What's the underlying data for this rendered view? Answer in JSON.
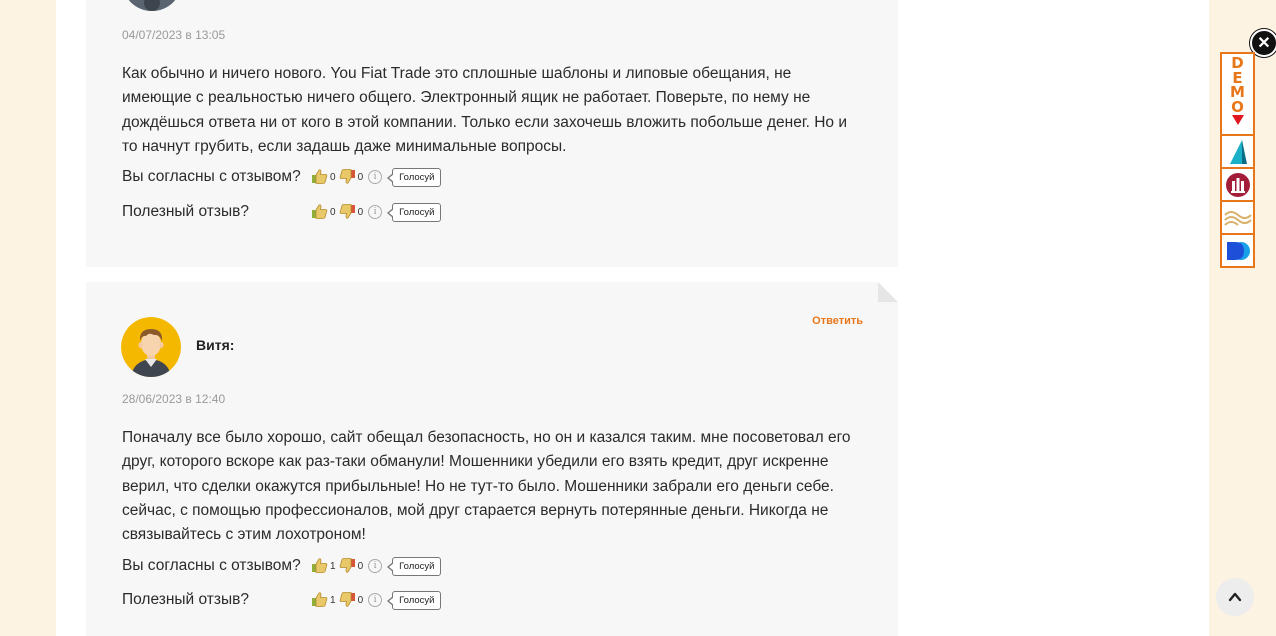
{
  "comments": [
    {
      "date": "04/07/2023 в 13:05",
      "text": "Как обычно и ничего нового. You Fiat Trade это сплошные шаблоны и липовые обещания, не имеющие с реальностью ничего общего. Электронный ящик не работает. Поверьте, по нему не дождёшься ответа ни от кого в этой компании. Только если захочешь вложить побольше денег. Но и то начнут грубить, если задашь даже минимальные вопросы.",
      "agree": {
        "question": "Вы согласны с отзывом?",
        "up": "0",
        "down": "0",
        "button": "Голосуй"
      },
      "useful": {
        "question": "Полезный отзыв?",
        "up": "0",
        "down": "0",
        "button": "Голосуй"
      }
    },
    {
      "author": "Витя:",
      "reply": "Ответить",
      "date": "28/06/2023 в 12:40",
      "text": "Поначалу все было хорошо, сайт обещал безопасность, но он и казался таким. мне посоветовал его друг, которого вскоре как раз-таки обманули! Мошенники убедили его взять кредит, друг искренне верил, что сделки окажутся прибыльные! Но не тут-то было. Мошенники забрали его деньги себе. сейчас, с помощью профессионалов, мой друг старается вернуть потерянные деньги. Никогда не связывайтесь с этим лохотроном!",
      "agree": {
        "question": "Вы согласны с отзывом?",
        "up": "1",
        "down": "0",
        "button": "Голосуй"
      },
      "useful": {
        "question": "Полезный отзыв?",
        "up": "1",
        "down": "0",
        "button": "Голосуй"
      }
    }
  ],
  "sidebar": {
    "demo_label": "DEMO",
    "icons": [
      "sail-logo-icon",
      "building-logo-icon",
      "wave-logo-icon",
      "p-logo-icon"
    ]
  },
  "info_glyph": "i",
  "colors": {
    "accent": "#e8761a",
    "card_bg": "#f7f7f7",
    "page_bg": "#fdf3e3",
    "avatar_bg": "#f5b800"
  }
}
